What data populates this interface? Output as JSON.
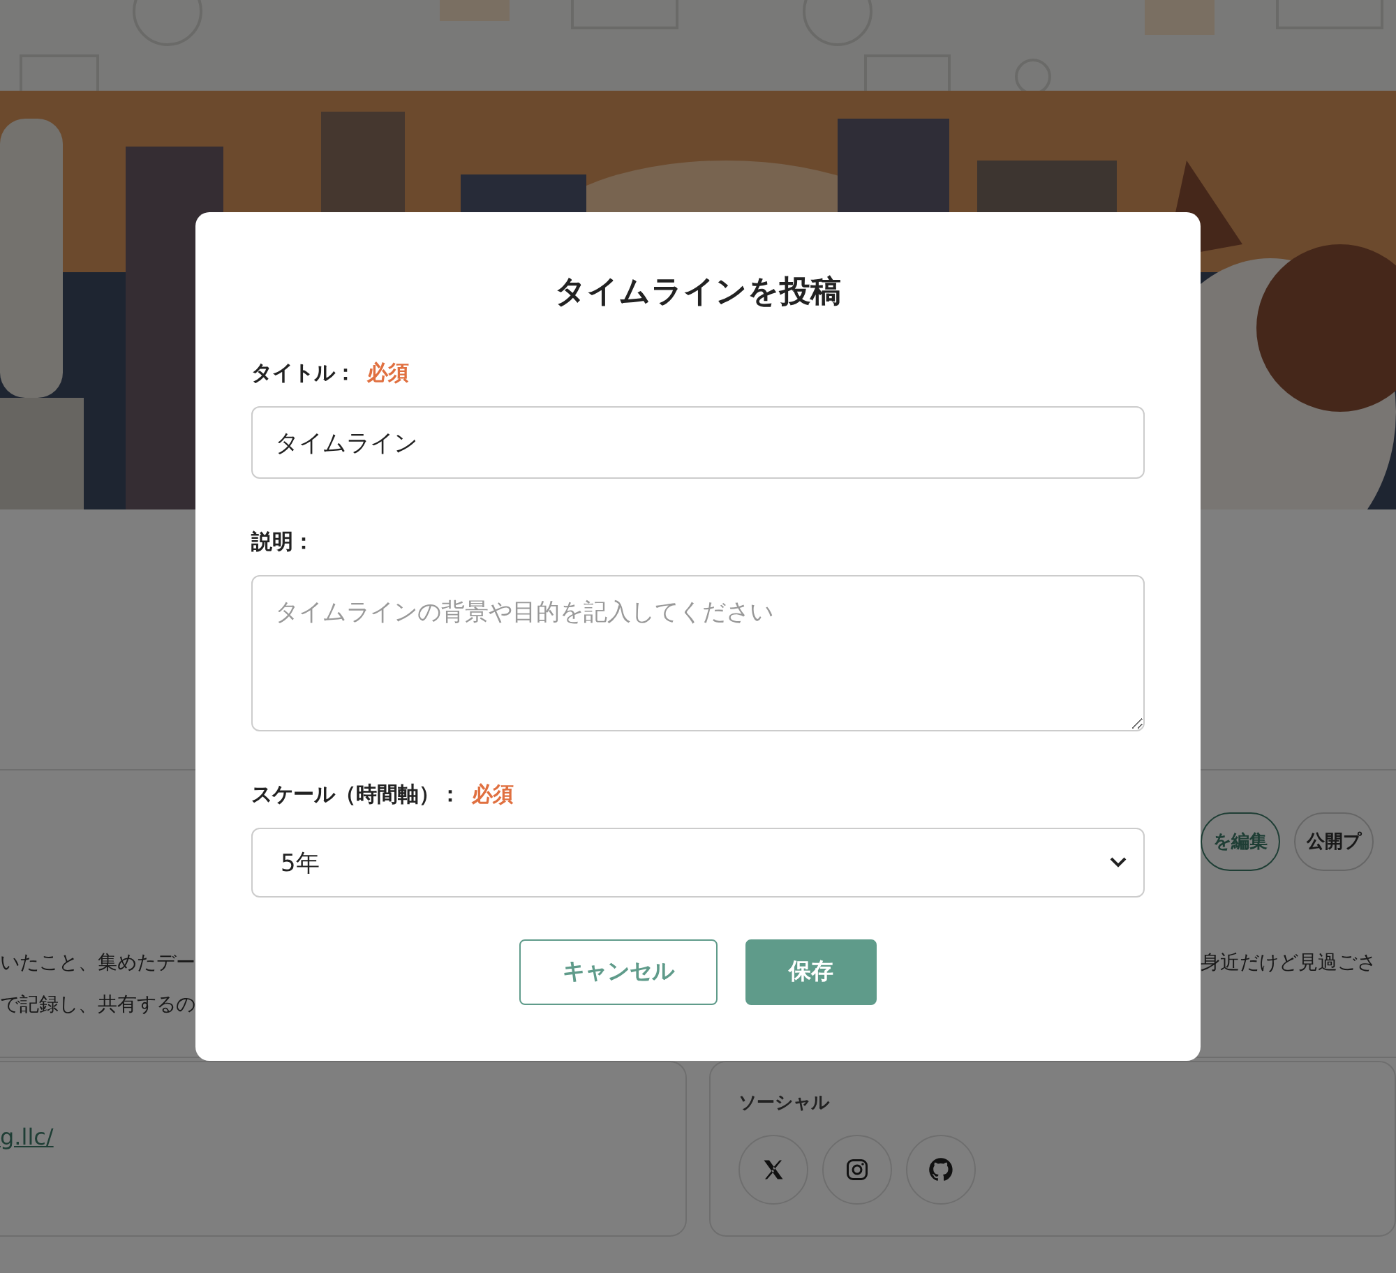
{
  "background_page": {
    "profile_buttons": [
      {
        "label": "を編集",
        "kind": "outline"
      },
      {
        "label": "公開プ",
        "kind": "plain"
      }
    ],
    "bio_left": [
      "いたこと、集めたデー",
      "で記録し、共有するの"
    ],
    "bio_right": "身近だけど見過ごさ",
    "link": "g.llc/",
    "social_heading": "ソーシャル"
  },
  "dialog": {
    "title": "タイムラインを投稿",
    "fields": [
      {
        "kind": "input",
        "label": "タイトル：",
        "required": "必須",
        "value": "タイムライン"
      },
      {
        "kind": "textarea",
        "label": "説明：",
        "placeholder": "タイムラインの背景や目的を記入してください"
      },
      {
        "kind": "select",
        "label": "スケール（時間軸）：",
        "required": "必須",
        "value": "5年"
      }
    ],
    "buttons": [
      {
        "label": "キャンセル",
        "kind": "secondary"
      },
      {
        "label": "保存",
        "kind": "primary"
      }
    ]
  }
}
